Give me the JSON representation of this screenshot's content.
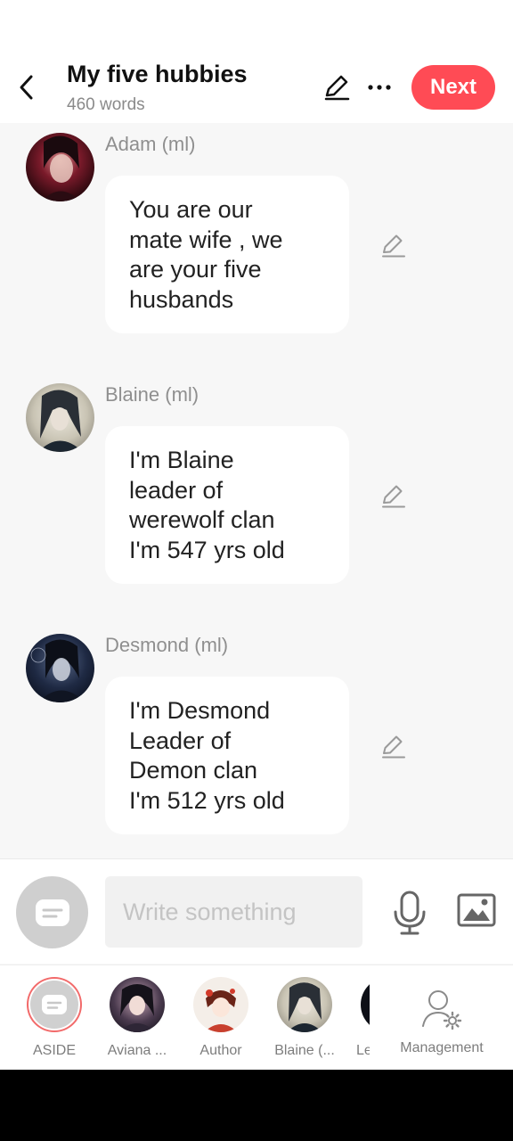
{
  "header": {
    "title": "My five hubbies",
    "word_count": "460 words",
    "next_label": "Next",
    "back_icon": "chevron-left-icon",
    "edit_icon": "pencil-icon",
    "more_icon": "more-horizontal-icon"
  },
  "messages": [
    {
      "speaker": "Adam (ml)",
      "lines": [
        "You are our",
        "mate wife , we",
        "are your five",
        "husbands"
      ]
    },
    {
      "speaker": "Blaine (ml)",
      "lines": [
        "I'm Blaine",
        "leader of",
        "werewolf clan",
        "I'm 547 yrs old"
      ]
    },
    {
      "speaker": "Desmond (ml)",
      "lines": [
        "I'm Desmond",
        "Leader of",
        "Demon clan",
        "I'm 512 yrs old"
      ]
    }
  ],
  "composer": {
    "placeholder": "Write something",
    "mode_icon": "aside-bubble-icon",
    "mic_icon": "microphone-icon",
    "image_icon": "image-icon"
  },
  "characters": {
    "items": [
      {
        "label": "ASIDE"
      },
      {
        "label": "Aviana ..."
      },
      {
        "label": "Author"
      },
      {
        "label": "Blaine (..."
      },
      {
        "label": "Le"
      }
    ],
    "management_label": "Management",
    "management_icon": "user-settings-icon"
  },
  "colors": {
    "accent": "#ff4b55",
    "background": "#f7f7f7",
    "bubble": "#ffffff",
    "muted_text": "#8f8f8f"
  }
}
